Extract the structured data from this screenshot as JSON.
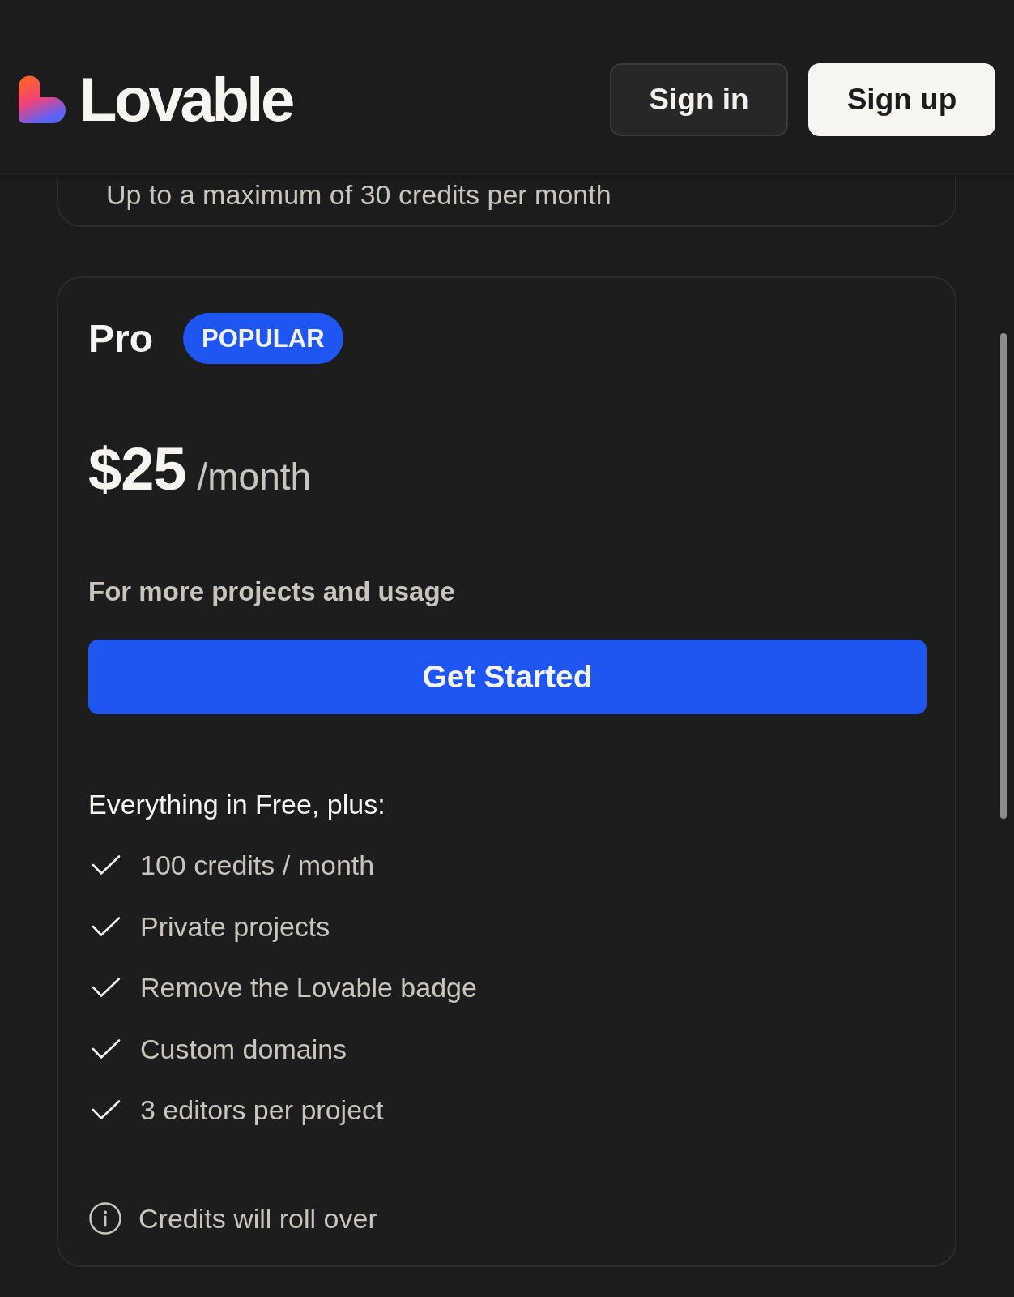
{
  "header": {
    "logo": {
      "wordmark": "Lovable"
    },
    "buttons": [
      {
        "label": "Sign in",
        "kind": "secondary"
      },
      {
        "label": "Sign up",
        "kind": "primary"
      }
    ]
  },
  "previous_plan": {
    "note": "Up to a maximum of 30 credits per month"
  },
  "plan": {
    "name": "Pro",
    "badge": "POPULAR",
    "price": "$25",
    "period": "/month",
    "description": "For more projects and usage",
    "cta": "Get Started",
    "features_heading": "Everything in Free, plus:",
    "features": [
      "100 credits / month",
      "Private projects",
      "Remove the Lovable badge",
      "Custom domains",
      "3 editors per project"
    ],
    "note": "Credits will roll over"
  }
}
